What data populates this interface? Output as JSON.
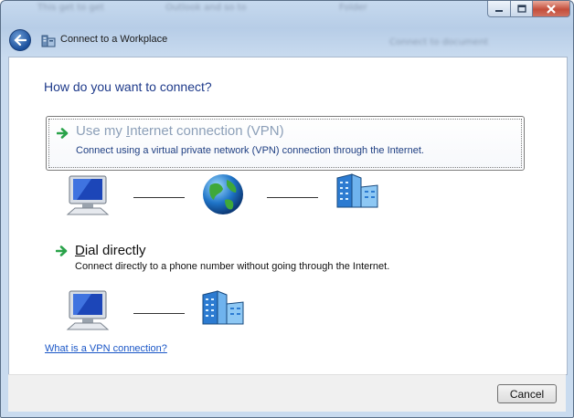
{
  "window": {
    "title": "Connect to a Workplace",
    "background_hints": [
      "This get to get",
      "Outlook and so to",
      "Folder",
      "Connect to document"
    ]
  },
  "main": {
    "heading": "How do you want to connect?",
    "options": [
      {
        "title_pre": "Use my ",
        "title_key": "I",
        "title_post": "nternet connection (VPN)",
        "description": "Connect using a virtual private network (VPN) connection through the Internet.",
        "icons": [
          "computer-icon",
          "globe-icon",
          "building-icon"
        ]
      },
      {
        "title_pre": "",
        "title_key": "D",
        "title_post": "ial directly",
        "description": "Connect directly to a phone number without going through the Internet.",
        "icons": [
          "computer-icon",
          "building-icon"
        ]
      }
    ],
    "help_link": "What is a VPN connection?"
  },
  "footer": {
    "cancel_label": "Cancel"
  },
  "colors": {
    "accent": "#1e3a8a",
    "link": "#1a56c7",
    "vpn_title": "#8c9fb8",
    "arrow": "#2aa34a"
  }
}
